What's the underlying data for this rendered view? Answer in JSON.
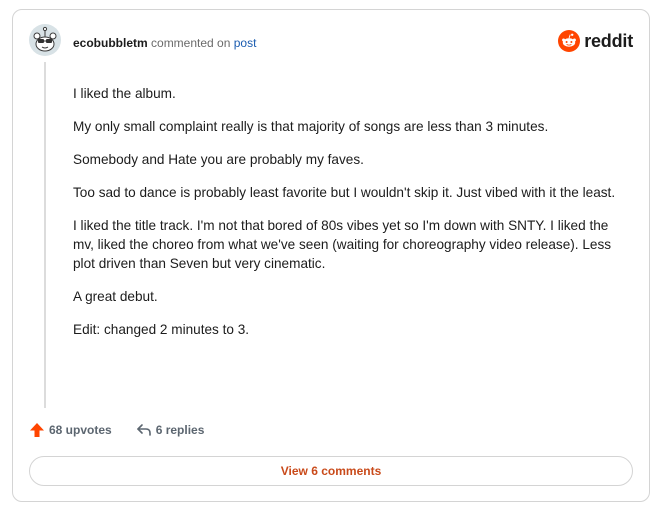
{
  "comment": {
    "author": "ecobubbletm",
    "action_text": "commented on",
    "target_link": "post",
    "paragraphs": [
      "I liked the album.",
      "My only small complaint really is that majority of songs are less than 3 minutes.",
      "Somebody and Hate you are probably my faves.",
      "Too sad to dance is probably least favorite but I wouldn't skip it. Just vibed with it the least.",
      "I liked the title track. I'm not that bored of 80s vibes yet so I'm down with SNTY. I liked the mv, liked the choreo from what we've seen (waiting for choreography video release). Less plot driven than Seven but very cinematic.",
      "A great debut.",
      "Edit: changed 2 minutes to 3."
    ]
  },
  "brand": {
    "name": "reddit",
    "icon": "reddit-logo-icon",
    "color": "#ff4500"
  },
  "actions": {
    "upvotes": "68 upvotes",
    "replies": "6 replies",
    "upvote_icon": "upvote-arrow-icon",
    "reply_icon": "reply-arrow-icon"
  },
  "footer": {
    "view_comments": "View 6 comments"
  },
  "colors": {
    "accent": "#ff4500",
    "link": "#1a5cb0",
    "button_text": "#c94a1a"
  }
}
